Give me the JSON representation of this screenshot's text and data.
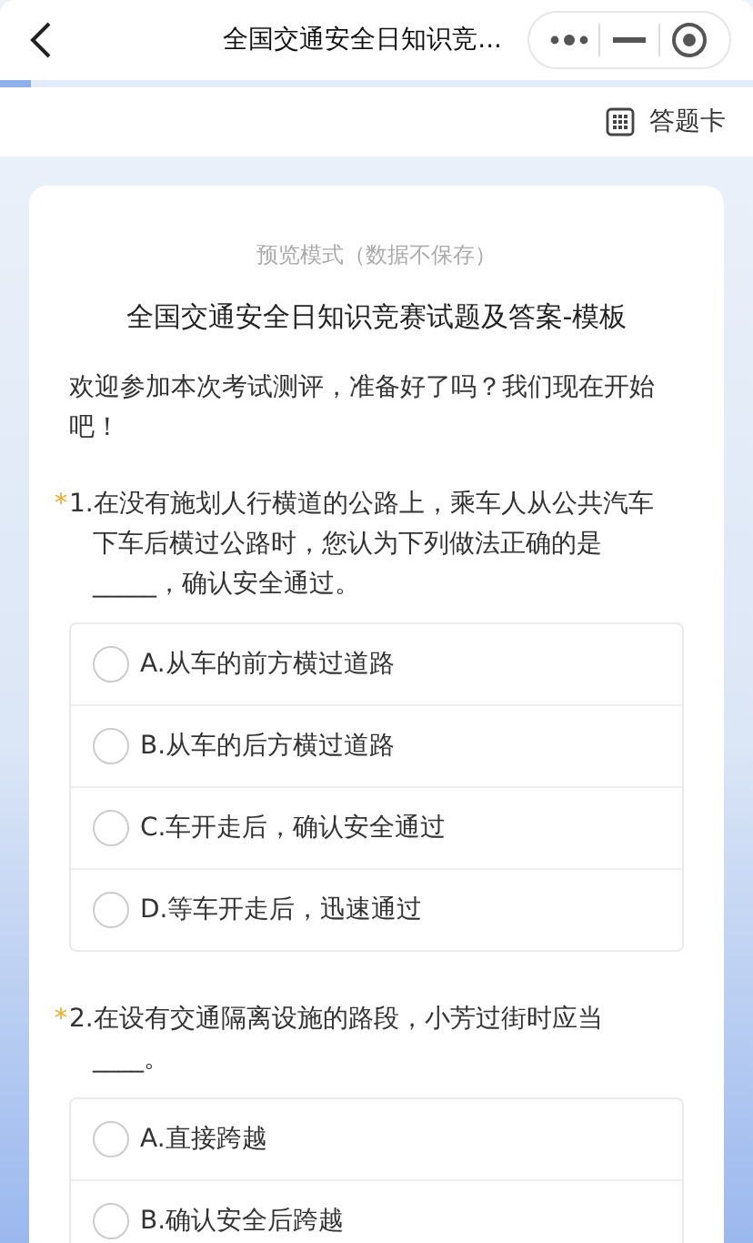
{
  "nav": {
    "title": "全国交通安全日知识竞...",
    "progress": {
      "level": 0.04
    }
  },
  "toolbar": {
    "answer_card": "答题卡"
  },
  "form": {
    "mode_note": "预览模式（数据不保存）",
    "title": "全国交通安全日知识竞赛试题及答案-模板",
    "intro": "欢迎参加本次考试测评，准备好了吗？我们现在开始吧！",
    "questions": [
      {
        "mark": "*",
        "text": "1.在没有施划人行横道的公路上，乘车人从公共汽车下车后横过公路时，您认为下列做法正确的是_____，确认安全通过。",
        "options": [
          {
            "label": "A.从车的前方横过道路",
            "selected": false
          },
          {
            "label": "B.从车的后方横过道路",
            "selected": false
          },
          {
            "label": "C.车开走后，确认安全通过",
            "selected": false
          },
          {
            "label": "D.等车开走后，迅速通过",
            "selected": false
          }
        ]
      },
      {
        "mark": "*",
        "text": "2.在设有交通隔离设施的路段，小芳过街时应当____。",
        "options": [
          {
            "label": "A.直接跨越",
            "selected": false
          },
          {
            "label": "B.确认安全后跨越",
            "selected": false
          }
        ]
      }
    ]
  }
}
